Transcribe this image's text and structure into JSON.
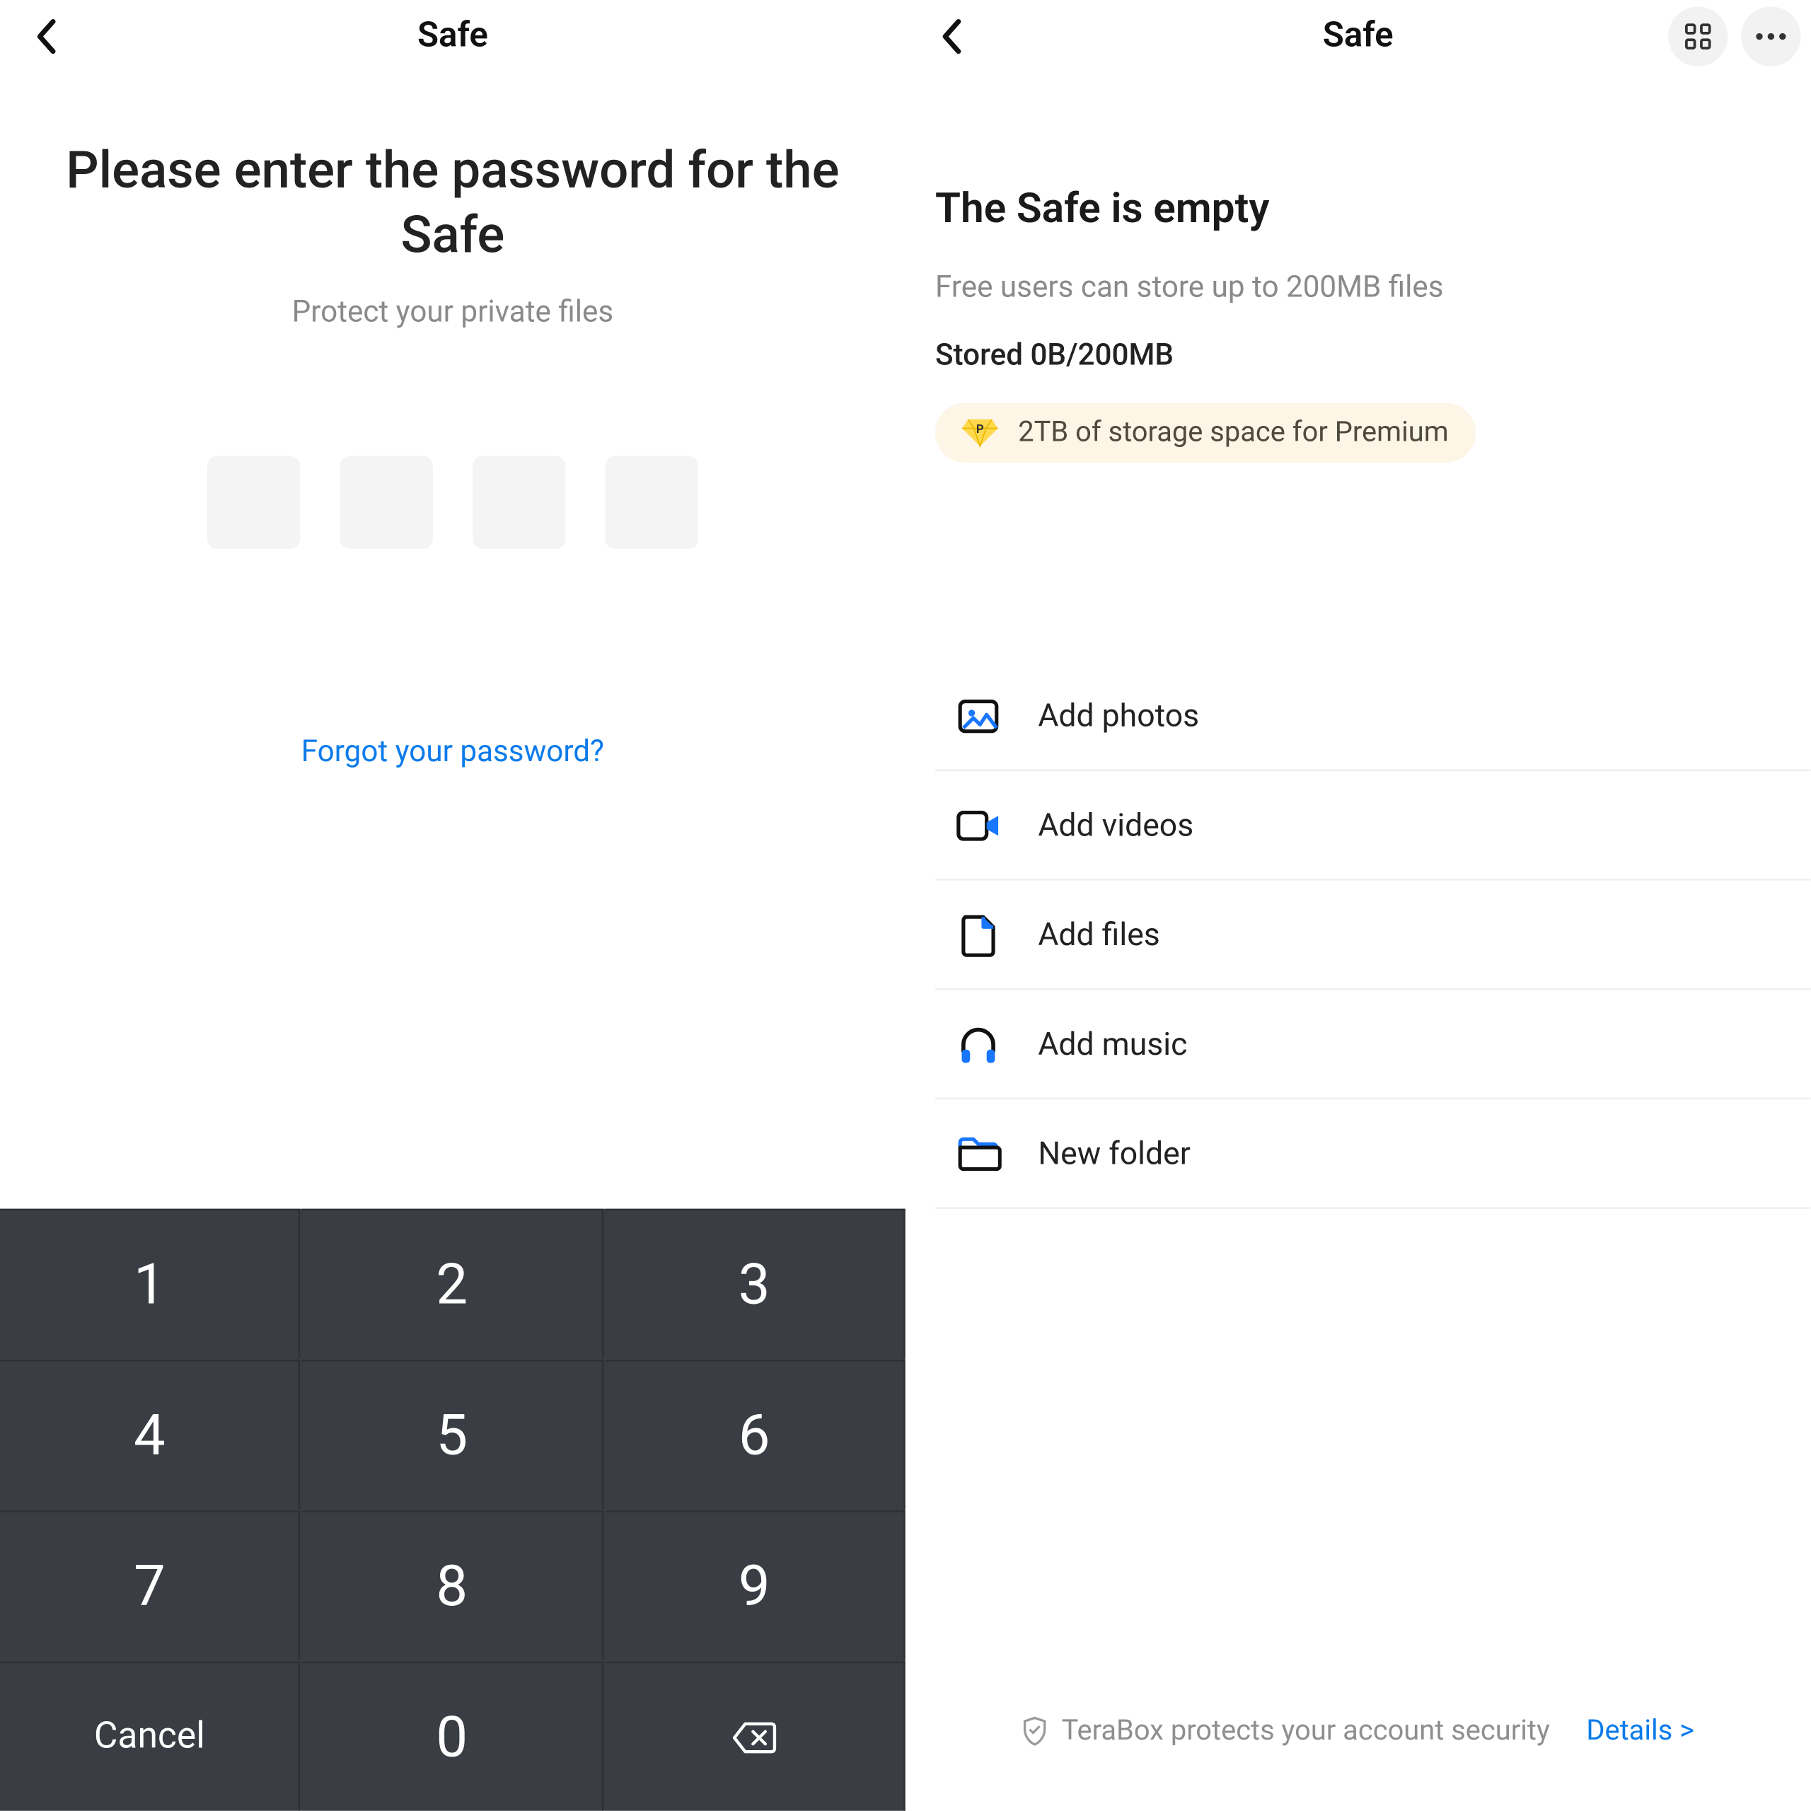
{
  "left": {
    "appbar_title": "Safe",
    "prompt_title": "Please enter the password for the Safe",
    "prompt_sub": "Protect your private files",
    "forgot": "Forgot your password?",
    "keypad": {
      "k1": "1",
      "k2": "2",
      "k3": "3",
      "k4": "4",
      "k5": "5",
      "k6": "6",
      "k7": "7",
      "k8": "8",
      "k9": "9",
      "cancel": "Cancel",
      "k0": "0"
    }
  },
  "right": {
    "appbar_title": "Safe",
    "title": "The Safe is empty",
    "sub": "Free users can store up to 200MB files",
    "storage": "Stored 0B/200MB",
    "premium": "2TB of storage space for Premium",
    "actions": {
      "photos": "Add photos",
      "videos": "Add videos",
      "files": "Add files",
      "music": "Add music",
      "folder": "New folder"
    },
    "footer_text": "TeraBox protects your account security",
    "footer_link": "Details >"
  }
}
